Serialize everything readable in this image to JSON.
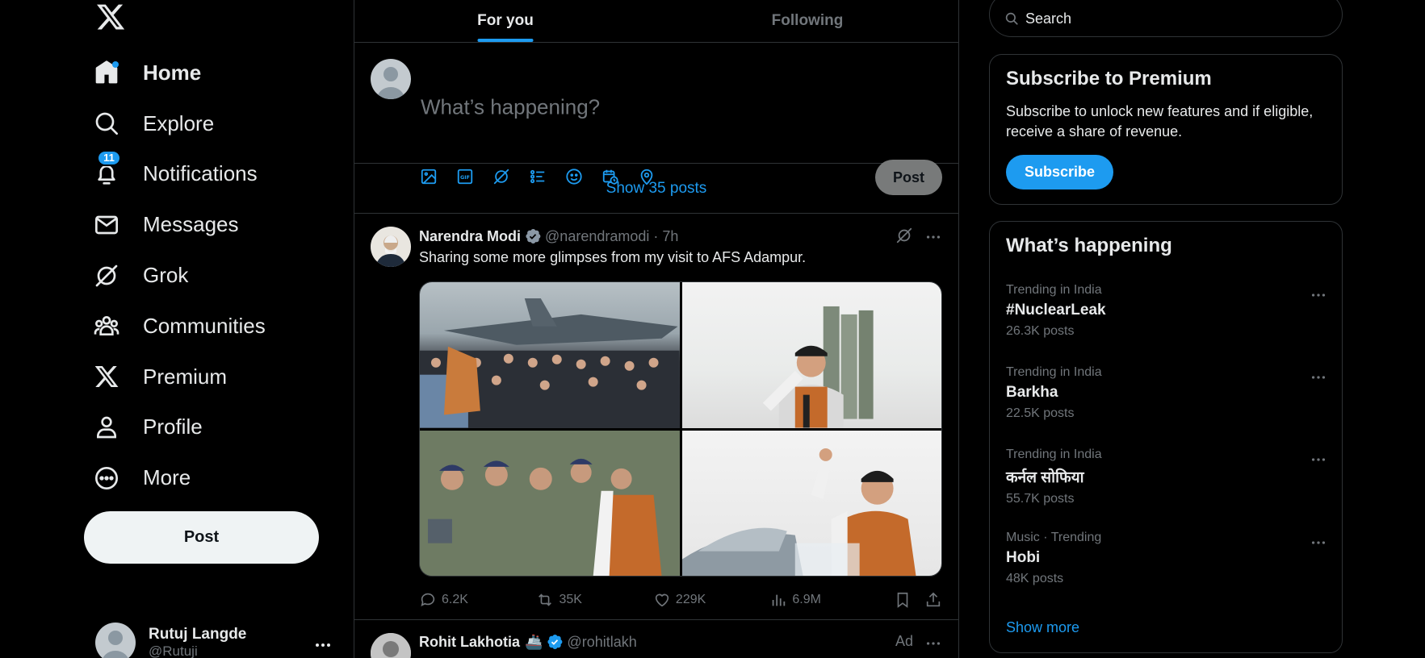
{
  "nav": {
    "items": [
      {
        "label": "Home",
        "icon": "home-icon"
      },
      {
        "label": "Explore",
        "icon": "search-icon"
      },
      {
        "label": "Notifications",
        "icon": "bell-icon",
        "badge": "11"
      },
      {
        "label": "Messages",
        "icon": "envelope-icon"
      },
      {
        "label": "Grok",
        "icon": "grok-icon"
      },
      {
        "label": "Communities",
        "icon": "people-icon"
      },
      {
        "label": "Premium",
        "icon": "x-logo-icon"
      },
      {
        "label": "Profile",
        "icon": "person-icon"
      },
      {
        "label": "More",
        "icon": "more-circle-icon"
      }
    ],
    "post_label": "Post",
    "user": {
      "name": "Rutuj Langde",
      "handle": "@Rutuji"
    }
  },
  "tabs": [
    {
      "label": "For you",
      "active": true
    },
    {
      "label": "Following",
      "active": false
    }
  ],
  "composer": {
    "placeholder": "What’s happening?",
    "post_label": "Post",
    "tools": [
      "image-icon",
      "gif-icon",
      "grok-icon",
      "poll-icon",
      "emoji-icon",
      "schedule-icon",
      "location-icon"
    ]
  },
  "show_posts": "Show 35 posts",
  "tweet": {
    "name": "Narendra Modi",
    "handle": "@narendramodi",
    "time": "7h",
    "text": "Sharing some more glimpses from my visit to AFS Adampur.",
    "replies": "6.2K",
    "reposts": "35K",
    "likes": "229K",
    "views": "6.9M"
  },
  "tweet2": {
    "name": "Rohit Lakhotia",
    "emoji": "🚢",
    "handle": "@rohitlakh",
    "ad": "Ad"
  },
  "right": {
    "search_placeholder": "Search",
    "premium": {
      "title": "Subscribe to Premium",
      "desc": "Subscribe to unlock new features and if eligible, receive a share of revenue.",
      "button": "Subscribe"
    },
    "happening": {
      "title": "What’s happening",
      "trends": [
        {
          "context": "Trending in India",
          "name": "#NuclearLeak",
          "count": "26.3K posts"
        },
        {
          "context": "Trending in India",
          "name": "Barkha",
          "count": "22.5K posts"
        },
        {
          "context": "Trending in India",
          "name": "कर्नल सोफिया",
          "count": "55.7K posts"
        },
        {
          "context": "Music · Trending",
          "name": "Hobi",
          "count": "48K posts"
        }
      ],
      "show_more": "Show more"
    }
  },
  "colors": {
    "accent": "#1d9bf0",
    "background": "#000000",
    "border": "#2f3336",
    "muted": "#71767b"
  }
}
